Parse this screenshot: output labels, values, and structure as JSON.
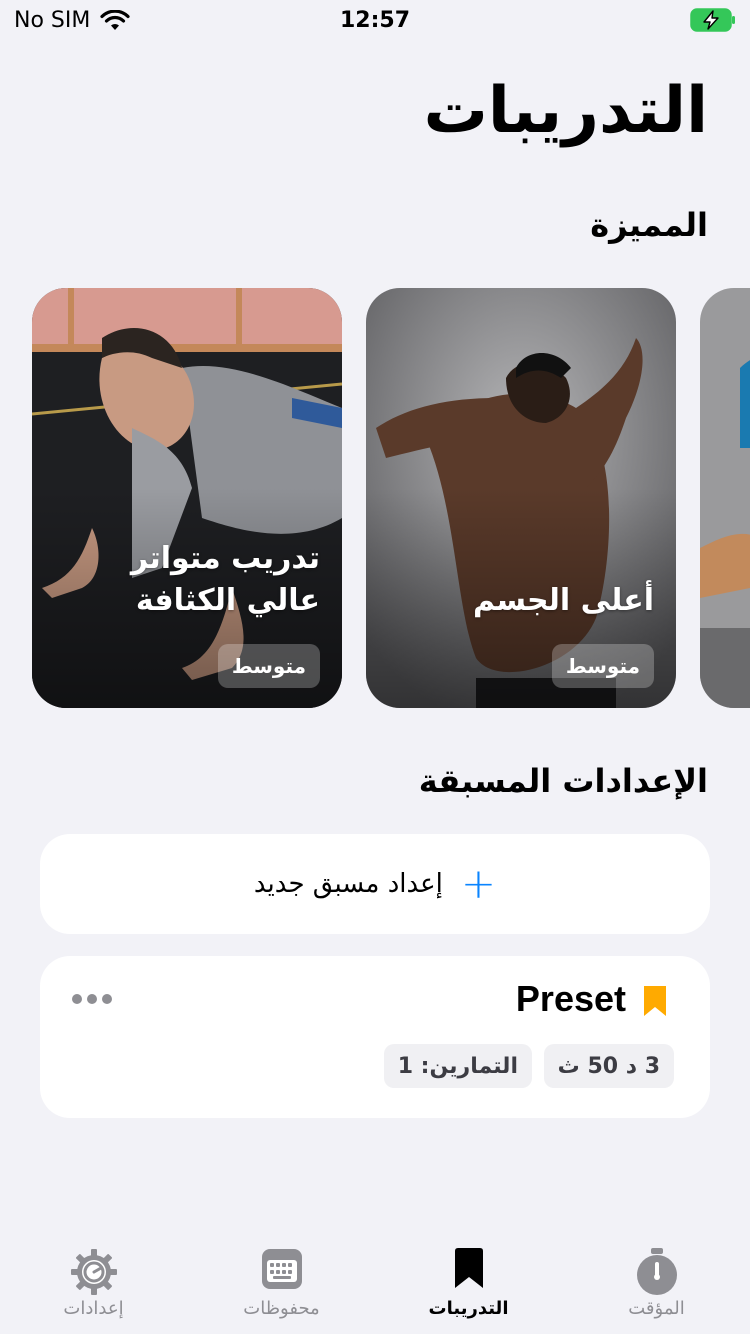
{
  "status_bar": {
    "carrier": "No SIM",
    "time": "12:57"
  },
  "page": {
    "title": "التدريبات"
  },
  "featured": {
    "title": "المميزة",
    "cards": [
      {
        "title": "تدريب متواتر عالي الكثافة",
        "level": "متوسط"
      },
      {
        "title": "أعلى الجسم",
        "level": "متوسط"
      }
    ]
  },
  "presets": {
    "title": "الإعدادات المسبقة",
    "new_label": "إعداد مسبق جديد",
    "items": [
      {
        "name": "Preset",
        "duration": "3 د 50 ث",
        "exercises": "التمارين: 1"
      }
    ]
  },
  "tabs": [
    {
      "label": "المؤقت",
      "icon": "stopwatch-icon",
      "active": false
    },
    {
      "label": "التدريبات",
      "icon": "bookmark-icon",
      "active": true
    },
    {
      "label": "محفوظات",
      "icon": "keyboard-icon",
      "active": false
    },
    {
      "label": "إعدادات",
      "icon": "gear-icon",
      "active": false
    }
  ],
  "colors": {
    "accent": "#0a84ff",
    "bookmark": "#ffaa00",
    "battery": "#34c759"
  }
}
